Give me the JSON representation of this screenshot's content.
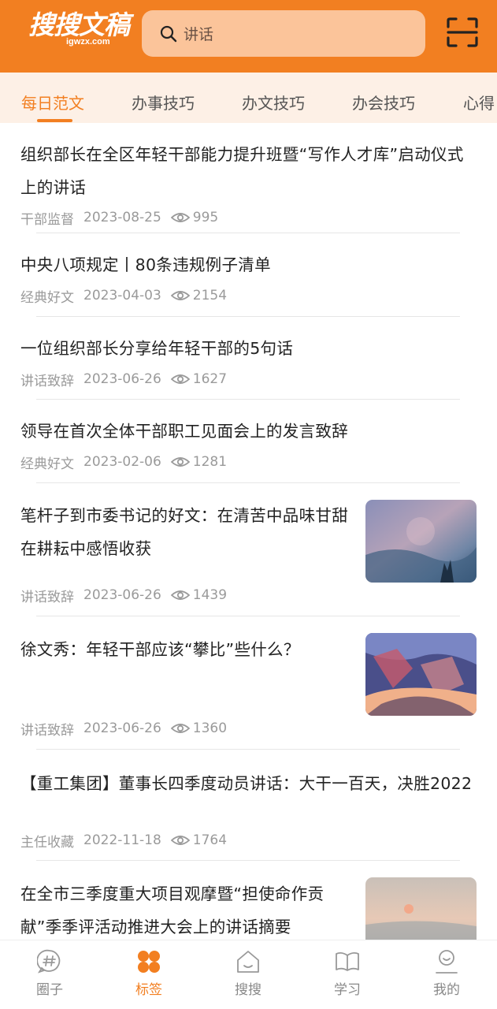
{
  "header": {
    "logo_text": "搜搜文稿",
    "logo_domain": "igwzx.com",
    "search_placeholder": "讲话"
  },
  "tabs": [
    {
      "label": "每日范文",
      "active": true
    },
    {
      "label": "办事技巧",
      "active": false
    },
    {
      "label": "办文技巧",
      "active": false
    },
    {
      "label": "办会技巧",
      "active": false
    },
    {
      "label": "心得",
      "active": false
    }
  ],
  "articles": [
    {
      "title": "组织部长在全区年轻干部能力提升班暨“写作人才库”启动仪式上的讲话",
      "category": "干部监督",
      "date": "2023-08-25",
      "views": "995",
      "has_thumbnail": false
    },
    {
      "title": "中央八项规定丨80条违规例子清单",
      "category": "经典好文",
      "date": "2023-04-03",
      "views": "2154",
      "has_thumbnail": false
    },
    {
      "title": "一位组织部长分享给年轻干部的5句话",
      "category": "讲话致辞",
      "date": "2023-06-26",
      "views": "1627",
      "has_thumbnail": false
    },
    {
      "title": "领导在首次全体干部职工见面会上的发言致辞",
      "category": "经典好文",
      "date": "2023-02-06",
      "views": "1281",
      "has_thumbnail": false
    },
    {
      "title": "笔杆子到市委书记的好文：在清苦中品味甘甜 在耕耘中感悟收获",
      "category": "讲话致辞",
      "date": "2023-06-26",
      "views": "1439",
      "has_thumbnail": true
    },
    {
      "title": "徐文秀：年轻干部应该“攀比”些什么？",
      "category": "讲话致辞",
      "date": "2023-06-26",
      "views": "1360",
      "has_thumbnail": true
    },
    {
      "title": "【重工集团】董事长四季度动员讲话：大干一百天，决胜2022",
      "category": "主任收藏",
      "date": "2022-11-18",
      "views": "1764",
      "has_thumbnail": false
    },
    {
      "title": "在全市三季度重大项目观摩暨“担使命作贡献”季季评活动推进大会上的讲话摘要",
      "category": "",
      "date": "",
      "views": "",
      "has_thumbnail": true
    }
  ],
  "bottom_nav": [
    {
      "label": "圈子",
      "icon": "hashtag-chat-icon",
      "active": false
    },
    {
      "label": "标签",
      "icon": "four-petal-grid-icon",
      "active": true
    },
    {
      "label": "搜搜",
      "icon": "home-icon",
      "active": false
    },
    {
      "label": "学习",
      "icon": "open-book-icon",
      "active": false
    },
    {
      "label": "我的",
      "icon": "user-icon",
      "active": false
    }
  ],
  "colors": {
    "brand": "#f27f21",
    "tab_bar_bg": "#fdf0e6",
    "search_bg": "#fbc49a",
    "meta_text": "#9a9a9a"
  }
}
